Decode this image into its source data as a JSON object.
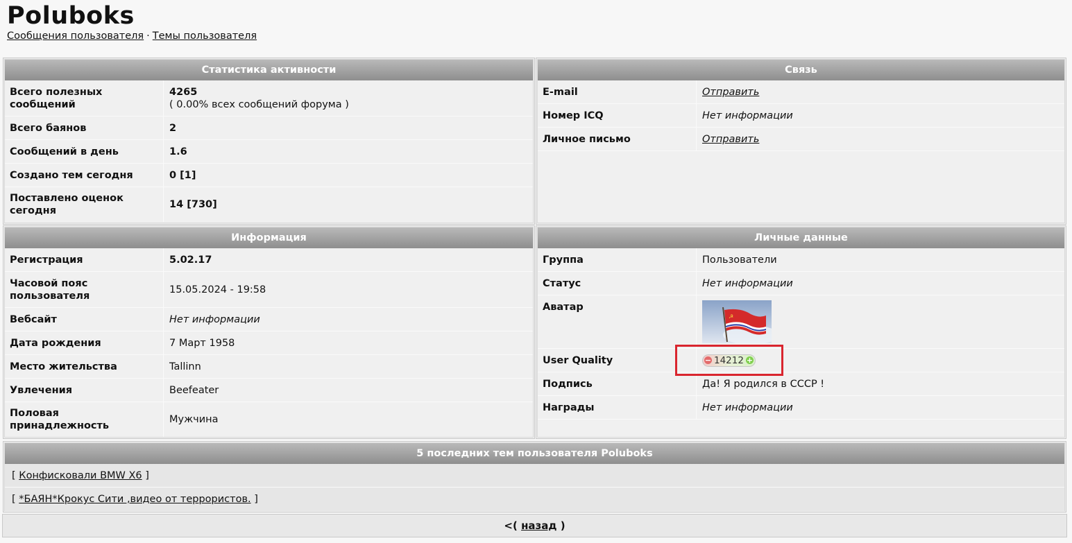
{
  "header": {
    "title": "Poluboks",
    "links": [
      "Сообщения пользователя",
      "Темы пользователя"
    ],
    "separator": "·"
  },
  "activity": {
    "title": "Статистика активности",
    "rows": [
      {
        "label": "Всего полезных сообщений",
        "value": "4265",
        "note": "( 0.00% всех сообщений форума )"
      },
      {
        "label": "Всего баянов",
        "value": "2"
      },
      {
        "label": "Сообщений в день",
        "value": "1.6"
      },
      {
        "label": "Создано тем сегодня",
        "value": "0 [1]"
      },
      {
        "label": "Поставлено оценок сегодня",
        "value": "14 [730]"
      }
    ]
  },
  "contact": {
    "title": "Связь",
    "rows": [
      {
        "label": "E-mail",
        "value": "Отправить"
      },
      {
        "label": "Номер ICQ",
        "value": "Нет информации"
      },
      {
        "label": "Личное письмо",
        "value": "Отправить"
      }
    ]
  },
  "info": {
    "title": "Информация",
    "rows": [
      {
        "label": "Регистрация",
        "value": "5.02.17"
      },
      {
        "label": "Часовой пояс пользователя",
        "value": "15.05.2024 - 19:58"
      },
      {
        "label": "Вебсайт",
        "value": "Нет информации"
      },
      {
        "label": "Дата рождения",
        "value": "7 Март 1958"
      },
      {
        "label": "Место жительства",
        "value": "Tallinn"
      },
      {
        "label": "Увлечения",
        "value": "Beefeater"
      },
      {
        "label": "Половая принадлежность",
        "value": "Мужчина"
      }
    ]
  },
  "personal": {
    "title": "Личные данные",
    "rows": [
      {
        "label": "Группа",
        "value": "Пользователи"
      },
      {
        "label": "Статус",
        "value": "Нет информации"
      },
      {
        "label": "Аватар"
      },
      {
        "label": "User Quality",
        "value": "14212",
        "minus": "−",
        "plus": "+"
      },
      {
        "label": "Подпись",
        "value": "Да! Я родился в СССР !"
      },
      {
        "label": "Награды",
        "value": "Нет информации"
      }
    ]
  },
  "topics": {
    "title": "5 последних тем пользователя Poluboks",
    "items": [
      "Конфисковали BMW X6",
      "*БАЯН*Крокус Сити ,видео от террористов."
    ],
    "bracket_open": "[",
    "bracket_close": "]"
  },
  "back": {
    "prefix": "<(",
    "label": "назад",
    "suffix": ")"
  },
  "colors": {
    "highlight": "#d9252e",
    "header_gradient_top": "#b9b9b9",
    "header_gradient_bottom": "#8e8e8e"
  },
  "icons": {
    "quality_minus": "minus-icon",
    "quality_plus": "plus-icon",
    "avatar": "flag-icon"
  }
}
